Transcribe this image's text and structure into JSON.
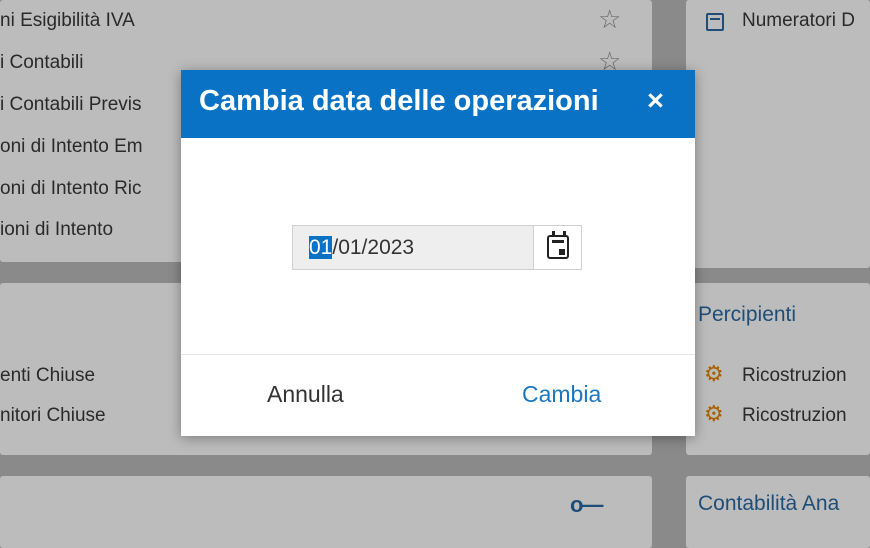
{
  "background": {
    "left_card_items": [
      "ni Esigibilità IVA",
      "i Contabili",
      "i Contabili Previs",
      "oni di Intento Em",
      "oni di Intento Ric",
      "ioni di Intento"
    ],
    "right_top_item": "Numeratori D",
    "left_mid_items": [
      "enti Chiuse",
      "nitori Chiuse"
    ],
    "percipienti_heading": "Percipienti",
    "percipienti_items": [
      "Ricostruzion",
      "Ricostruzion"
    ],
    "contabilita_heading": "Contabilità Ana"
  },
  "modal": {
    "title": "Cambia data delle operazioni",
    "close_label": "×",
    "date_selected_part": "01",
    "date_rest": "/01/2023",
    "cancel_label": "Annulla",
    "confirm_label": "Cambia"
  },
  "colors": {
    "header_blue": "#0a72c4",
    "link_blue": "#1a78c2",
    "gear_orange": "#a86300"
  },
  "icons": [
    "star-icon",
    "calendar-icon",
    "gear-icon",
    "key-icon",
    "close-icon"
  ]
}
